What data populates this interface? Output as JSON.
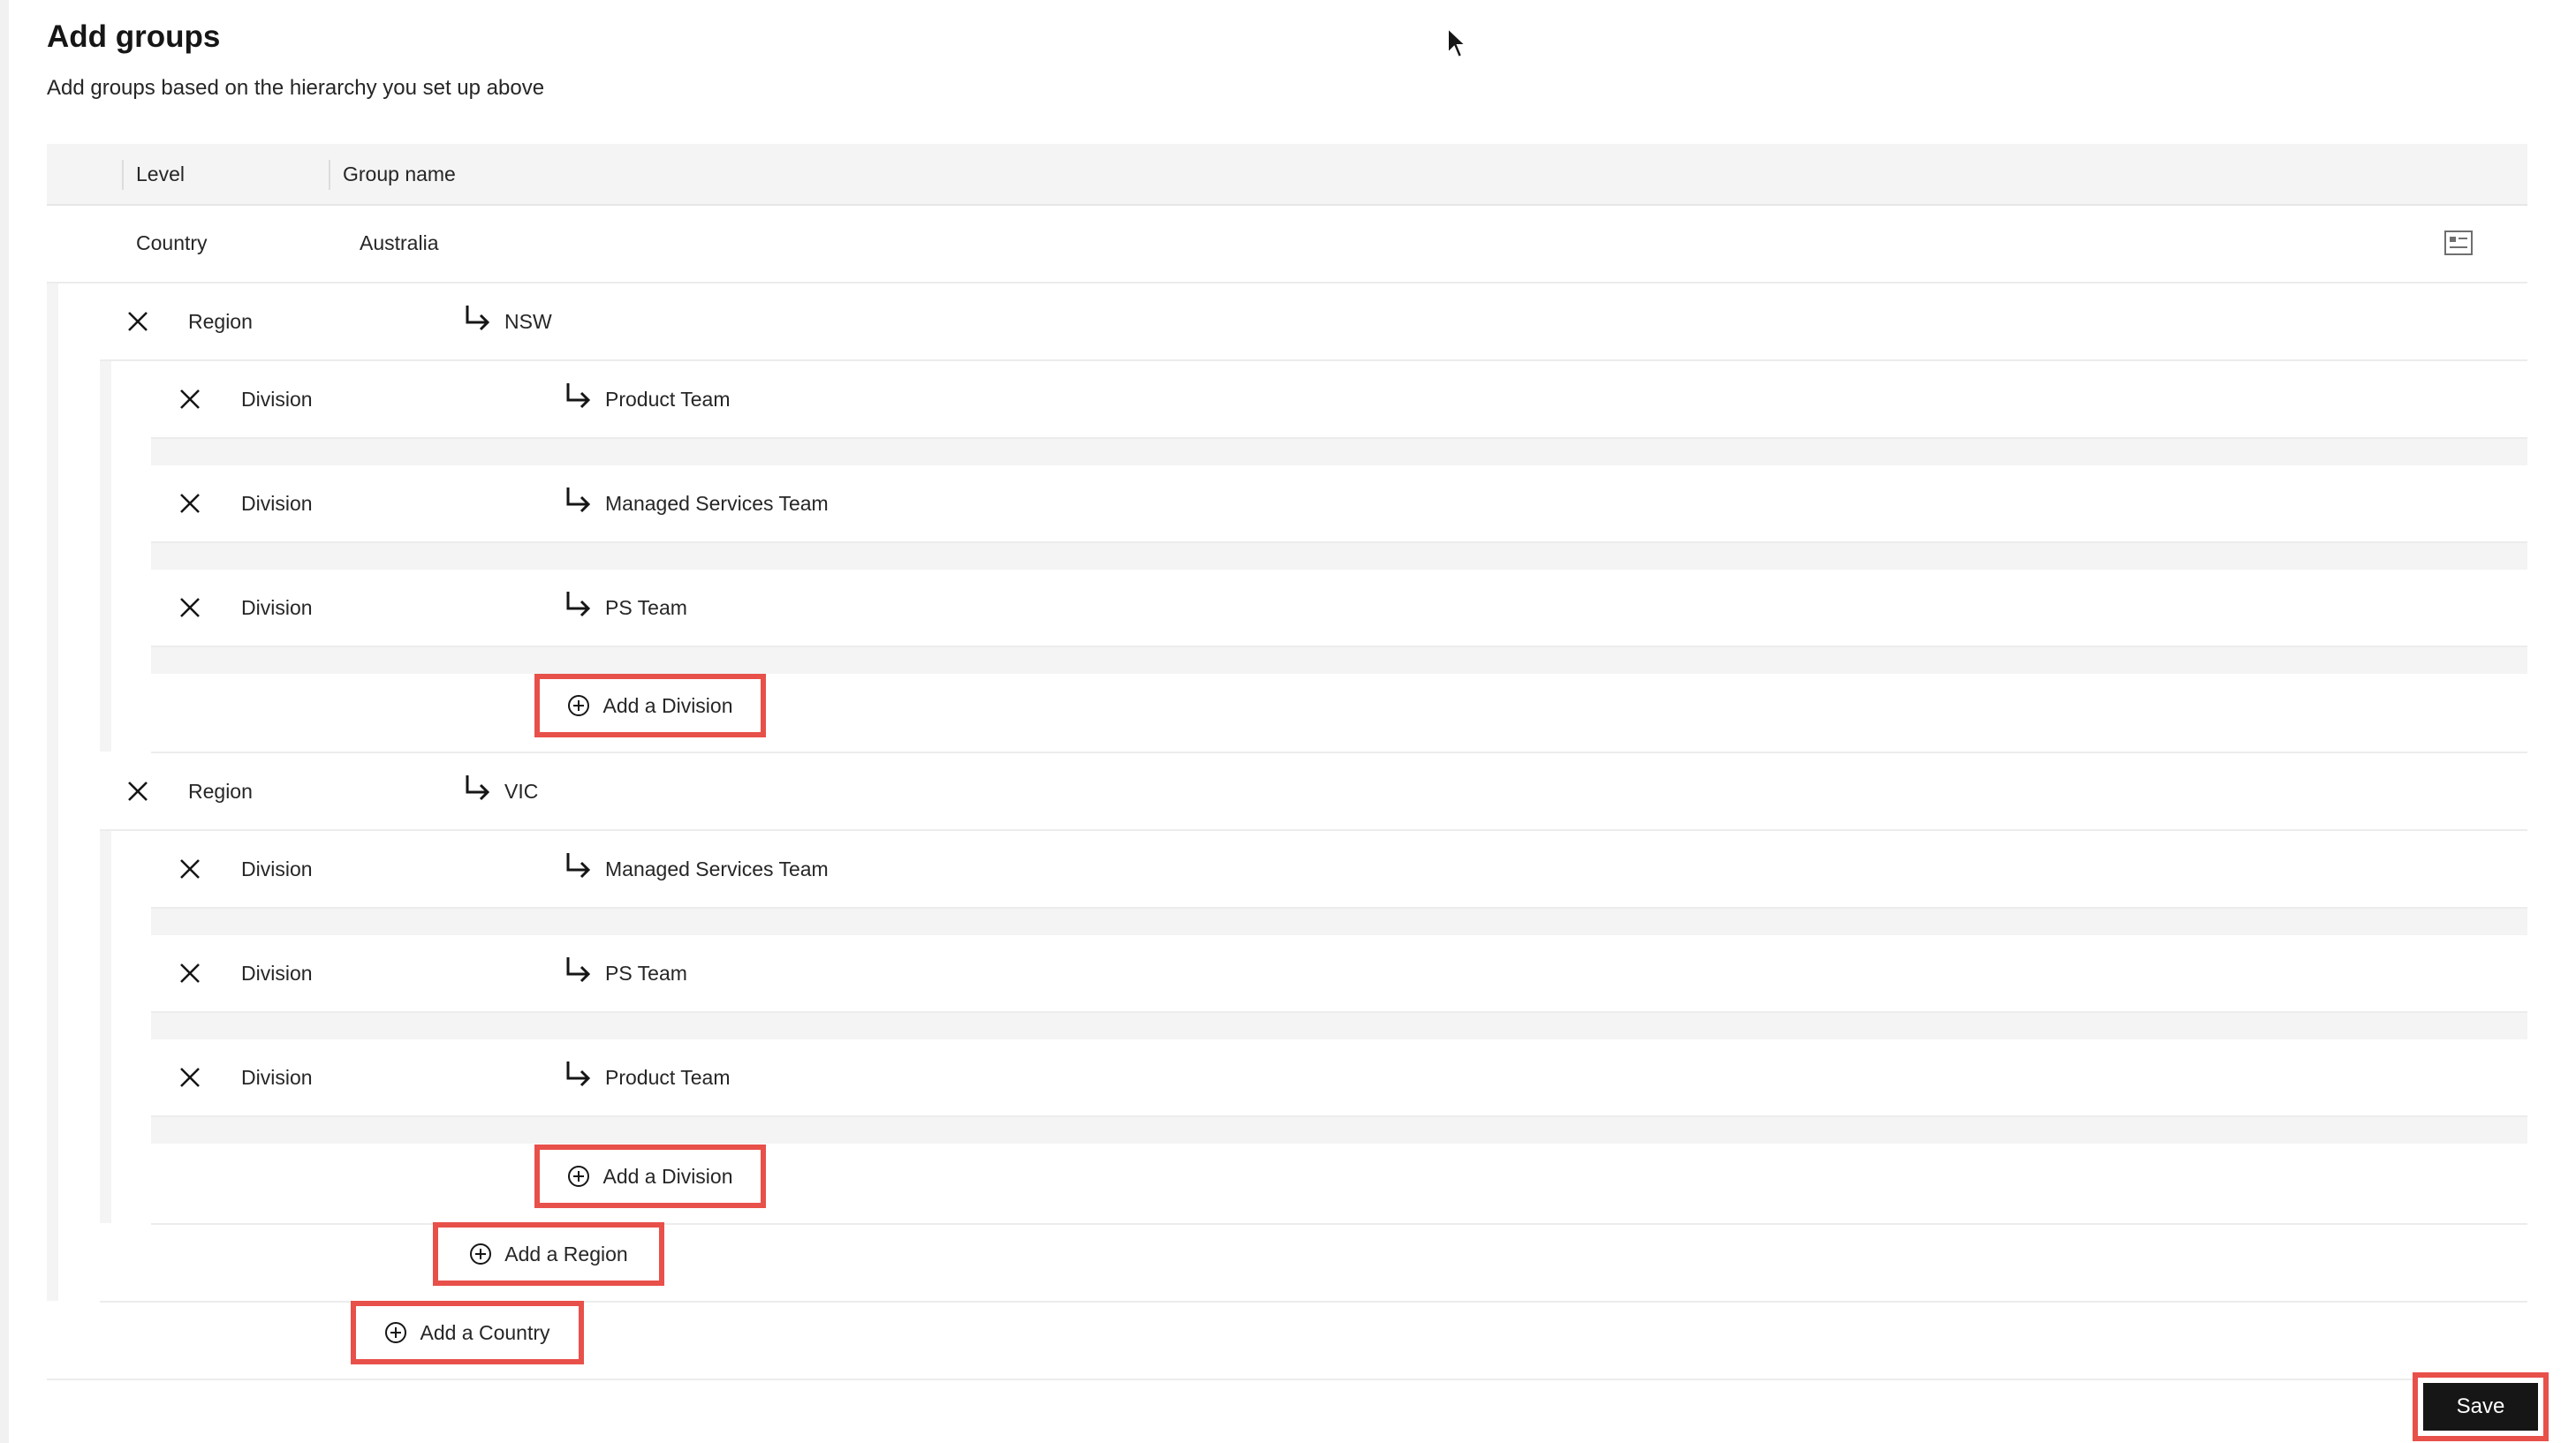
{
  "header": {
    "title": "Add groups",
    "subtitle": "Add groups based on the hierarchy you set up above"
  },
  "table": {
    "columns": [
      "Level",
      "Group name"
    ],
    "country": {
      "level": "Country",
      "name": "Australia",
      "icon": "list-detail-icon"
    },
    "regions": [
      {
        "level": "Region",
        "name": "NSW",
        "divisions": [
          {
            "level": "Division",
            "name": "Product Team"
          },
          {
            "level": "Division",
            "name": "Managed Services Team"
          },
          {
            "level": "Division",
            "name": "PS Team"
          }
        ],
        "add_division_label": "Add a Division"
      },
      {
        "level": "Region",
        "name": "VIC",
        "divisions": [
          {
            "level": "Division",
            "name": "Managed Services Team"
          },
          {
            "level": "Division",
            "name": "PS Team"
          },
          {
            "level": "Division",
            "name": "Product Team"
          }
        ],
        "add_division_label": "Add a Division"
      }
    ],
    "add_region_label": "Add a Region",
    "add_country_label": "Add a Country"
  },
  "footer": {
    "save_label": "Save"
  },
  "colors": {
    "highlight": "#e8504a",
    "primary": "#161616",
    "rail": "#f4f4f4"
  },
  "icons": {
    "remove": "close-x-icon",
    "child": "child-arrow-icon",
    "add": "add-circle-icon"
  }
}
